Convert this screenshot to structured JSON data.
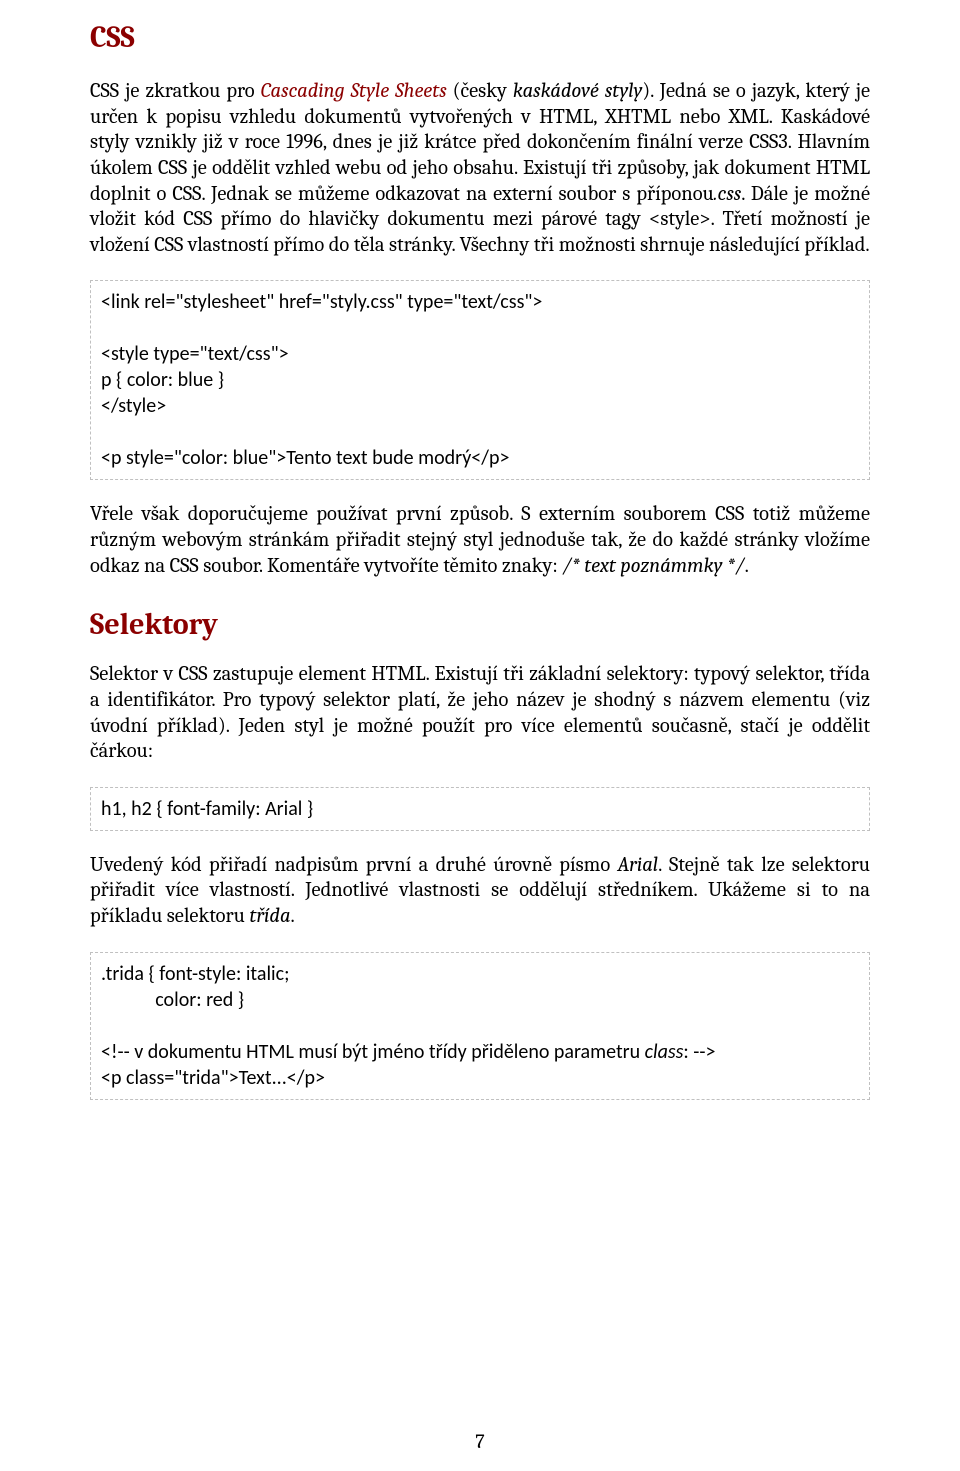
{
  "headings": {
    "css": "CSS",
    "selektory": "Selektory"
  },
  "para1": {
    "t1": "CSS je zkratkou pro ",
    "redi1": "Cascading Style Sheets",
    "t2": " (česky ",
    "ital1": "kaskádové styly",
    "t3": "). Jedná se o jazyk, který je určen k popisu vzhledu dokumentů vytvořených v HTML, XHTML nebo XML. Kaskádové styly vznikly již v roce 1996, dnes je již krátce před dokončením finální verze CSS3. Hlavním úkolem CSS je oddělit vzhled webu od jeho obsahu. Existují tři způsoby, jak dokument HTML doplnit o CSS. Jednak se můžeme odkazovat na externí soubor s příponou",
    "ital2": ".css",
    "t4": ". Dále je možné vložit kód CSS přímo do hlavičky dokumentu mezi párové tagy <style>. Třetí možností je vložení CSS vlastností přímo do těla stránky. Všechny tři možnosti shrnuje následující příklad."
  },
  "code1": "<link rel=\"stylesheet\" href=\"styly.css\" type=\"text/css\">\n\n<style type=\"text/css\">\np { color: blue }\n</style>\n\n<p style=\"color: blue\">Tento text bude modrý</p>",
  "para2": {
    "t1": "Vřele však doporučujeme používat první způsob. S externím souborem CSS totiž můžeme různým webovým stránkám přiřadit stejný styl jednoduše tak, že do každé stránky vložíme odkaz na CSS soubor. Komentáře vytvoříte těmito znaky: ",
    "ital1": "/* text poznámmky */",
    "t2": "."
  },
  "para3": "Selektor v CSS zastupuje element HTML. Existují tři základní selektory: typový selektor, třída a identifikátor. Pro typový selektor platí, že jeho název je shodný s názvem elementu (viz úvodní příklad). Jeden styl je možné použít pro více elementů současně, stačí je oddělit čárkou:",
  "code2": "h1, h2 { font-family: Arial }",
  "para4": {
    "t1": "Uvedený kód přiřadí nadpisům první a druhé úrovně písmo ",
    "ital1": "Arial",
    "t2": ". Stejně tak lze selektoru přiřadit více vlastností. Jednotlivé vlastnosti se oddělují středníkem. Ukážeme si to na příkladu selektoru ",
    "ital2": "třída",
    "t3": "."
  },
  "code3": {
    "line1": ".trida { font-style: italic;",
    "line2": "            color: red }",
    "gap": "",
    "line3a": "<!-- v dokumentu HTML musí být jméno třídy přiděleno parametru ",
    "line3ital": "class",
    "line3b": ": -->",
    "line4": "<p class=\"trida\">Text...</p>"
  },
  "pagenum": "7"
}
